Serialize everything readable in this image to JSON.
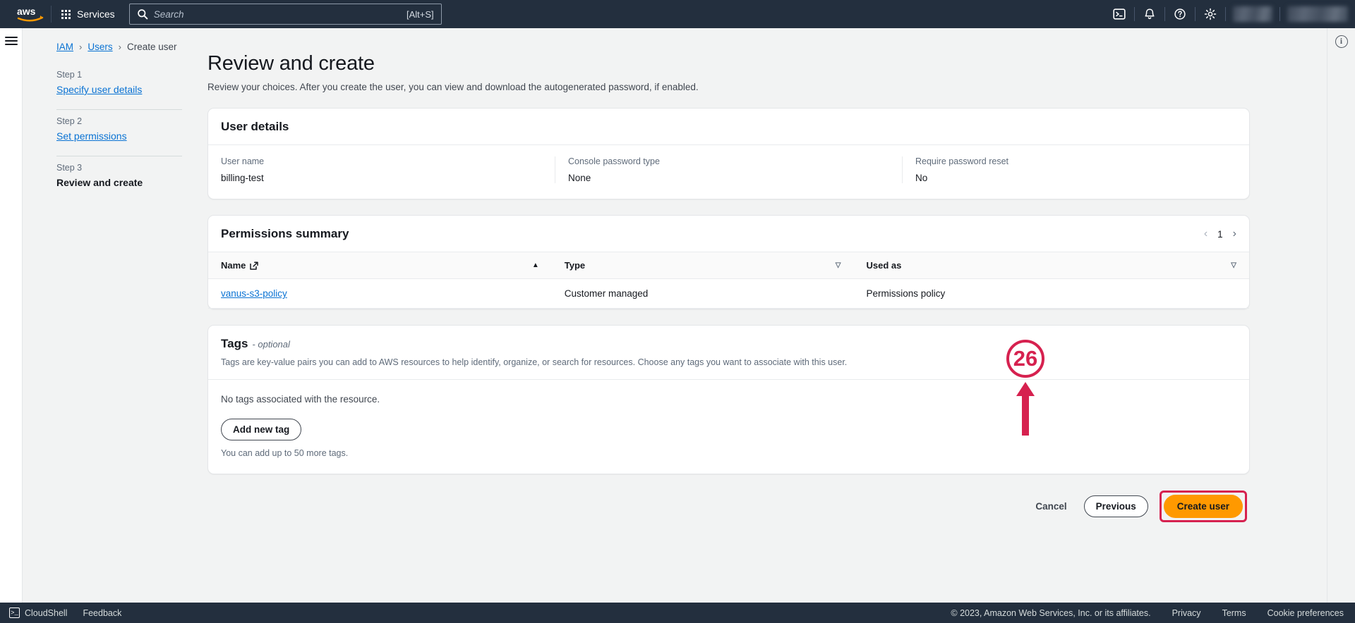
{
  "topnav": {
    "logo_alt": "aws",
    "services_label": "Services",
    "search_placeholder": "Search",
    "search_value": "",
    "search_shortcut": "[Alt+S]",
    "icons": [
      "cloudshell-icon",
      "notifications-bell-icon",
      "help-circle-icon",
      "settings-gear-icon"
    ],
    "region_selector": "",
    "account_menu": ""
  },
  "breadcrumb": {
    "items": [
      {
        "label": "IAM",
        "type": "link"
      },
      {
        "label": "Users",
        "type": "link"
      },
      {
        "label": "Create user",
        "type": "current"
      }
    ],
    "separator": "›"
  },
  "stepnav": {
    "steps": [
      {
        "number": "Step 1",
        "label": "Specify user details",
        "current": false
      },
      {
        "number": "Step 2",
        "label": "Set permissions",
        "current": false
      },
      {
        "number": "Step 3",
        "label": "Review and create",
        "current": true
      }
    ]
  },
  "main": {
    "title": "Review and create",
    "subtitle": "Review your choices. After you create the user, you can view and download the autogenerated password, if enabled."
  },
  "user_details": {
    "title": "User details",
    "fields": [
      {
        "key": "User name",
        "value": "billing-test"
      },
      {
        "key": "Console password type",
        "value": "None"
      },
      {
        "key": "Require password reset",
        "value": "No"
      }
    ]
  },
  "permissions_summary": {
    "title": "Permissions summary",
    "pagination": {
      "prev": "‹",
      "page": "1",
      "next": "›"
    },
    "columns": [
      {
        "label": "Name",
        "sort": "asc",
        "external_link": true
      },
      {
        "label": "Type",
        "sort": "filter",
        "external_link": false
      },
      {
        "label": "Used as",
        "sort": "filter",
        "external_link": false
      }
    ],
    "rows": [
      {
        "name": "vanus-s3-policy",
        "type": "Customer managed",
        "used_as": "Permissions policy"
      }
    ]
  },
  "tags": {
    "title": "Tags",
    "optional_label": "- optional",
    "description": "Tags are key-value pairs you can add to AWS resources to help identify, organize, or search for resources. Choose any tags you want to associate with this user.",
    "empty_message": "No tags associated with the resource.",
    "add_button": "Add new tag",
    "limit_note": "You can add up to 50 more tags."
  },
  "actions": {
    "cancel": "Cancel",
    "previous": "Previous",
    "create": "Create user"
  },
  "annotation": {
    "number": "26",
    "color": "#d6214f"
  },
  "footer": {
    "cloudshell": "CloudShell",
    "feedback": "Feedback",
    "copyright": "© 2023, Amazon Web Services, Inc. or its affiliates.",
    "links": [
      "Privacy",
      "Terms",
      "Cookie preferences"
    ]
  },
  "colors": {
    "nav_background": "#232f3e",
    "page_background": "#f2f3f3",
    "link": "#0972d3",
    "primary_button": "#ff9900",
    "annotation": "#d6214f"
  }
}
